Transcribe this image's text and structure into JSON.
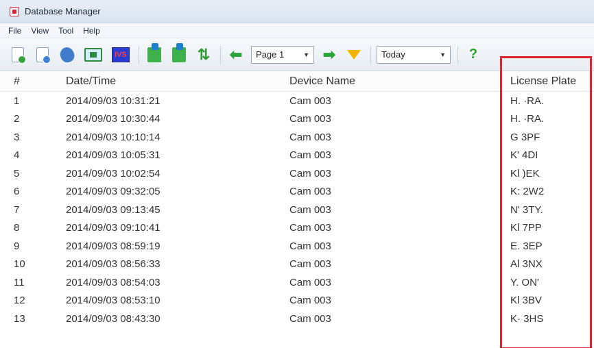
{
  "window": {
    "title": "Database Manager"
  },
  "menu": [
    "File",
    "View",
    "Tool",
    "Help"
  ],
  "toolbar": {
    "ivs_label": "IVS",
    "page_value": "Page 1",
    "date_value": "Today",
    "help_glyph": "?"
  },
  "table": {
    "columns": [
      "#",
      "Date/Time",
      "Device Name",
      "License Plate"
    ],
    "rows": [
      {
        "num": "1",
        "datetime": "2014/09/03 10:31:21",
        "device": "Cam 003",
        "plate": "H.  ·RA."
      },
      {
        "num": "2",
        "datetime": "2014/09/03 10:30:44",
        "device": "Cam 003",
        "plate": "H.  ·RA."
      },
      {
        "num": "3",
        "datetime": "2014/09/03 10:10:14",
        "device": "Cam 003",
        "plate": "G    3PF"
      },
      {
        "num": "4",
        "datetime": "2014/09/03 10:05:31",
        "device": "Cam 003",
        "plate": "K'   4DI"
      },
      {
        "num": "5",
        "datetime": "2014/09/03 10:02:54",
        "device": "Cam 003",
        "plate": "Kl   )EK"
      },
      {
        "num": "6",
        "datetime": "2014/09/03 09:32:05",
        "device": "Cam 003",
        "plate": "K:   2W2"
      },
      {
        "num": "7",
        "datetime": "2014/09/03 09:13:45",
        "device": "Cam 003",
        "plate": "N'   3TY."
      },
      {
        "num": "8",
        "datetime": "2014/09/03 09:10:41",
        "device": "Cam 003",
        "plate": "Kl   7PP"
      },
      {
        "num": "9",
        "datetime": "2014/09/03 08:59:19",
        "device": "Cam 003",
        "plate": "E.   3EP"
      },
      {
        "num": "10",
        "datetime": "2014/09/03 08:56:33",
        "device": "Cam 003",
        "plate": "Al   3NX"
      },
      {
        "num": "11",
        "datetime": "2014/09/03 08:54:03",
        "device": "Cam 003",
        "plate": "Y.   ON'"
      },
      {
        "num": "12",
        "datetime": "2014/09/03 08:53:10",
        "device": "Cam 003",
        "plate": "Kl   3BV"
      },
      {
        "num": "13",
        "datetime": "2014/09/03 08:43:30",
        "device": "Cam 003",
        "plate": "K·   3HS"
      }
    ]
  },
  "colors": {
    "highlight": "#e0242f",
    "accent_green": "#2ba33a"
  }
}
